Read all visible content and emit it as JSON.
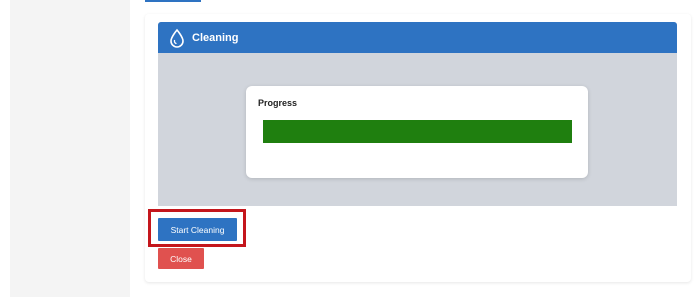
{
  "panel": {
    "title": "Cleaning",
    "icon": "water-drop-icon"
  },
  "progress": {
    "label": "Progress",
    "value_fraction": 1.0,
    "bar_color": "#1f7f0f"
  },
  "actions": {
    "start_label": "Start Cleaning",
    "close_label": "Close"
  },
  "colors": {
    "header": "#2e73c2",
    "start_button": "#2e73c2",
    "close_button": "#e0514f",
    "highlight": "#c4161c",
    "panel_body": "#d1d5dc"
  }
}
